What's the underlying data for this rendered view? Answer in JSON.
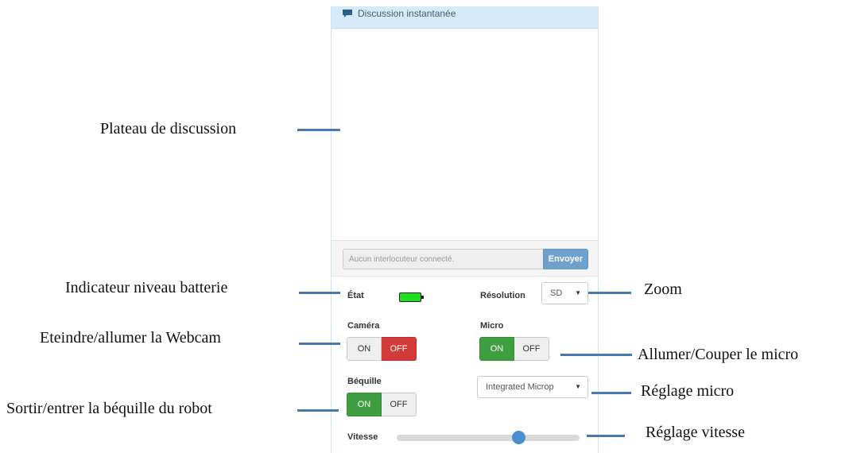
{
  "panel": {
    "title": "Discussion instantanée",
    "chat_placeholder": "Aucun interlocuteur connecté.",
    "send_label": "Envoyer",
    "etat_label": "État",
    "battery": {
      "level": 1.0,
      "color": "#1fe01f"
    },
    "resolution_label": "Résolution",
    "resolution_value": "SD",
    "camera_label": "Caméra",
    "camera_on": "ON",
    "camera_off": "OFF",
    "micro_label": "Micro",
    "micro_on": "ON",
    "micro_off": "OFF",
    "bequille_label": "Béquille",
    "bequille_on": "ON",
    "bequille_off": "OFF",
    "mic_device_value": "Integrated Microp",
    "vitesse_label": "Vitesse",
    "vitesse_value": 0.68
  },
  "annotations": {
    "chat_board": "Plateau de discussion",
    "battery_indicator": "Indicateur niveau batterie",
    "webcam_toggle": "Eteindre/allumer la Webcam",
    "crutch_toggle": "Sortir/entrer la béquille du robot",
    "zoom": "Zoom",
    "micro_toggle": "Allumer/Couper le micro",
    "micro_setting": "Réglage micro",
    "speed_setting": "Réglage vitesse"
  },
  "colors": {
    "header_bg": "#d6ebf8",
    "send_button": "#6fa1cf",
    "toggle_on": "#3f9e3f",
    "toggle_off_active": "#d33a3a",
    "slider_thumb": "#4a8fcf",
    "annotation_line": "#4a79b0"
  },
  "icons": {
    "chat": "chat-bubble-icon",
    "caret": "caret-down-icon"
  }
}
